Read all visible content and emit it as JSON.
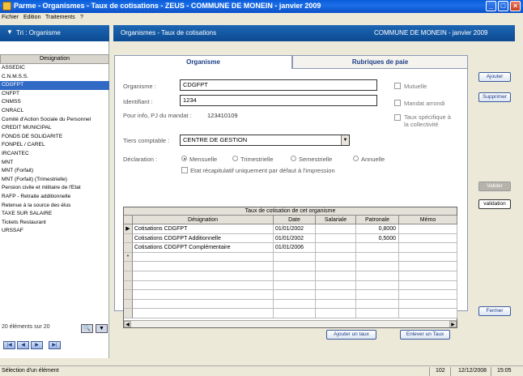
{
  "window": {
    "title": "Parme - Organismes - Taux de cotisations - ZEUS - COMMUNE DE MONEIN - janvier 2009"
  },
  "menu": [
    "Fichier",
    "Edition",
    "Traitements",
    "?"
  ],
  "left_header": {
    "label": "Tri : Organisme"
  },
  "main_header": {
    "left": "Organismes - Taux de cotisations",
    "right": "COMMUNE DE MONEIN - janvier 2009"
  },
  "list": {
    "header": "Designation",
    "items": [
      "ASSEDIC",
      "C.N.M.S.S.",
      "CDGFPT",
      "CNFPT",
      "CNMSS",
      "CNRACL",
      "Comité d'Action Sociale du Personnel",
      "CREDIT MUNICIPAL",
      "FONDS DE SOLIDARITE",
      "FONPEL / CAREL",
      "IRCANTEC",
      "MNT",
      "MNT (Forfait)",
      "MNT (Forfait) (Trimestrielle)",
      "Pension civile et militaire de l'Etat",
      "RAFP - Retraite additionnelle",
      "Retenue à la source des élus",
      "TAXE SUR SALAIRE",
      "Tickets Restaurant",
      "URSSAF"
    ],
    "selected_index": 2,
    "count": "20 éléments sur 20"
  },
  "tabs": {
    "active": "Organisme",
    "inactive": "Rubriques de paie"
  },
  "form": {
    "organisme_label": "Organisme :",
    "organisme_value": "CDGFPT",
    "identifiant_label": "Identifiant :",
    "identifiant_value": "1234",
    "pj_label": "Pour info, PJ du mandat :",
    "pj_value": "123410109",
    "tiers_label": "Tiers comptable :",
    "tiers_value": "CENTRE DE GESTION",
    "declaration_label": "Déclaration :",
    "declaration_options": [
      "Mensuelle",
      "Trimestrielle",
      "Semestrielle",
      "Annuelle"
    ],
    "etat_label": "Etat récapitulatif uniquement par défaut à l'impression",
    "mutuelle_label": "Mutuelle",
    "mandat_label": "Mandat arrondi",
    "taux_label_1": "Taux spécifique à",
    "taux_label_2": "la collectivité"
  },
  "grid": {
    "caption": "Taux de cotisation de cet organisme",
    "columns": [
      "Désignation",
      "Date",
      "Salariale",
      "Patronale",
      "Mémo"
    ],
    "rows": [
      [
        "Cotisations CDGFPT",
        "01/01/2002",
        "",
        "0,8000",
        ""
      ],
      [
        "Cotisations CDGFPT Additionnelle",
        "01/01/2002",
        "",
        "0,5000",
        ""
      ],
      [
        "Cotisations CDGFPT Complémentaire",
        "01/01/2006",
        "",
        "",
        ""
      ]
    ],
    "new_row_marker": "*",
    "current_row_marker": "▶"
  },
  "buttons": {
    "ajouter_taux": "Ajouter un taux",
    "enlever_taux": "Enlever un Taux",
    "ajouter": "Ajouter",
    "supprimer": "Supprimer",
    "valider": "Valider",
    "validation": "validation",
    "fermer": "Fermer"
  },
  "status": {
    "message": "Sélection d'un élément",
    "code": "102",
    "date": "12/12/2008",
    "time": "15:05"
  },
  "colors": {
    "title_blue": "#0a5bd8",
    "header_blue": "#1d67b4",
    "selection": "#316ac5"
  }
}
